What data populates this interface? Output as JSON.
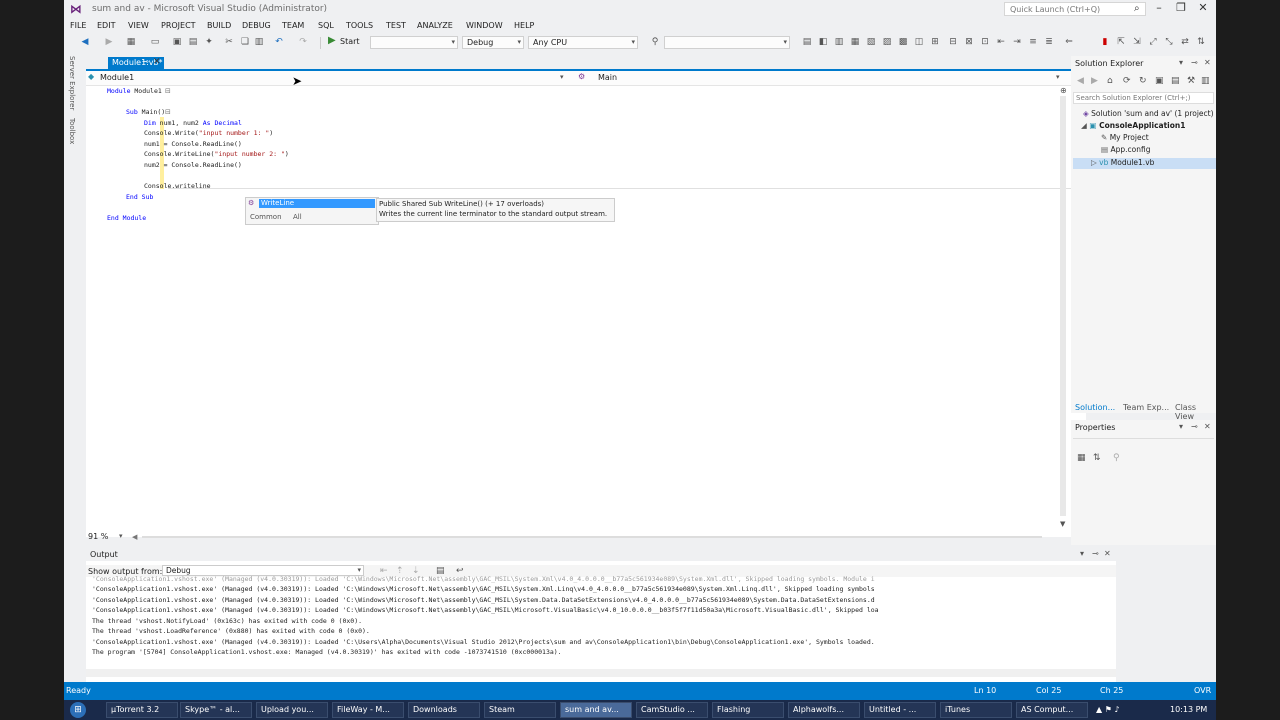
{
  "window_title": "sum and av - Microsoft Visual Studio (Administrator)",
  "quick_launch_placeholder": "Quick Launch (Ctrl+Q)",
  "menu": [
    "FILE",
    "EDIT",
    "VIEW",
    "PROJECT",
    "BUILD",
    "DEBUG",
    "TEAM",
    "SQL",
    "TOOLS",
    "TEST",
    "ANALYZE",
    "WINDOW",
    "HELP"
  ],
  "toolbar": {
    "start_label": "Start",
    "config": "Debug",
    "platform": "Any CPU"
  },
  "side_tabs": [
    "Server Explorer",
    "Toolbox"
  ],
  "document_tab": "Module1.vb*",
  "editor": {
    "nav_left": "Module1",
    "nav_right": "Main",
    "zoom": "91 %"
  },
  "code": {
    "l1_kw": "Module",
    "l1_rest": " Module1",
    "l2_kw": "Sub",
    "l2_rest": " Main()",
    "l3_kw": "Dim",
    "l3_rest": " num1, num2 ",
    "l3_kw2": "As",
    "l3_type": " Decimal",
    "l4_a": "Console.Write(",
    "l4_str": "\"input number 1: \"",
    "l4_b": ")",
    "l5": "num1 = Console.ReadLine()",
    "l6_a": "Console.WriteLine(",
    "l6_str": "\"input number 2: \"",
    "l6_b": ")",
    "l7": "num2 = Console.ReadLine()",
    "l8": "Console.writeline",
    "l9": "End Sub",
    "l10": "End Module"
  },
  "intellisense": {
    "selected": "WriteLine",
    "tab_common": "Common",
    "tab_all": "All",
    "tooltip_sig": "Public Shared Sub WriteLine() (+ 17 overloads)",
    "tooltip_desc": "Writes the current line terminator to the standard output stream."
  },
  "solution_explorer": {
    "title": "Solution Explorer",
    "search_placeholder": "Search Solution Explorer (Ctrl+;)",
    "solution": "Solution 'sum and av' (1 project)",
    "project": "ConsoleApplication1",
    "items": [
      "My Project",
      "App.config",
      "Module1.vb"
    ],
    "bottom_tabs": [
      "Solution...",
      "Team Exp...",
      "Class View"
    ]
  },
  "properties": {
    "title": "Properties"
  },
  "output": {
    "title": "Output",
    "show_from_label": "Show output from:",
    "show_from_value": "Debug",
    "lines": [
      "'ConsoleApplication1.vshost.exe' (Managed (v4.0.30319)): Loaded 'C:\\Windows\\Microsoft.Net\\assembly\\GAC_MSIL\\System.Xml\\v4.0_4.0.0.0__b77a5c561934e089\\System.Xml.dll', Skipped loading symbols. Module i",
      "'ConsoleApplication1.vshost.exe' (Managed (v4.0.30319)): Loaded 'C:\\Windows\\Microsoft.Net\\assembly\\GAC_MSIL\\System.Xml.Linq\\v4.0_4.0.0.0__b77a5c561934e089\\System.Xml.Linq.dll', Skipped loading symbols",
      "'ConsoleApplication1.vshost.exe' (Managed (v4.0.30319)): Loaded 'C:\\Windows\\Microsoft.Net\\assembly\\GAC_MSIL\\System.Data.DataSetExtensions\\v4.0_4.0.0.0__b77a5c561934e089\\System.Data.DataSetExtensions.d",
      "'ConsoleApplication1.vshost.exe' (Managed (v4.0.30319)): Loaded 'C:\\Windows\\Microsoft.Net\\assembly\\GAC_MSIL\\Microsoft.VisualBasic\\v4.0_10.0.0.0__b03f5f7f11d50a3a\\Microsoft.VisualBasic.dll', Skipped loa",
      "The thread 'vshost.NotifyLoad' (0x163c) has exited with code 0 (0x0).",
      "The thread 'vshost.LoadReference' (0x880) has exited with code 0 (0x0).",
      "'ConsoleApplication1.vshost.exe' (Managed (v4.0.30319)): Loaded 'C:\\Users\\Alpha\\Documents\\Visual Studio 2012\\Projects\\sum and av\\ConsoleApplication1\\bin\\Debug\\ConsoleApplication1.exe', Symbols loaded.",
      "The program '[5704] ConsoleApplication1.vshost.exe: Managed (v4.0.30319)' has exited with code -1073741510 (0xc000013a)."
    ]
  },
  "status": {
    "ready": "Ready",
    "ln": "Ln 10",
    "col": "Col 25",
    "ch": "Ch 25",
    "ovr": "OVR"
  },
  "taskbar": {
    "apps": [
      "µTorrent 3.2",
      "Skype™ - al...",
      "Upload you...",
      "FileWay - M...",
      "Downloads",
      "Steam",
      "sum and av...",
      "CamStudio ...",
      "Flashing",
      "Alphawolfs...",
      "Untitled - ...",
      "iTunes",
      "AS Comput..."
    ],
    "clock": "10:13 PM"
  },
  "colors": {
    "accent": "#007acc",
    "keyword": "#0000ff",
    "string": "#a31515",
    "type": "#2b91af"
  }
}
